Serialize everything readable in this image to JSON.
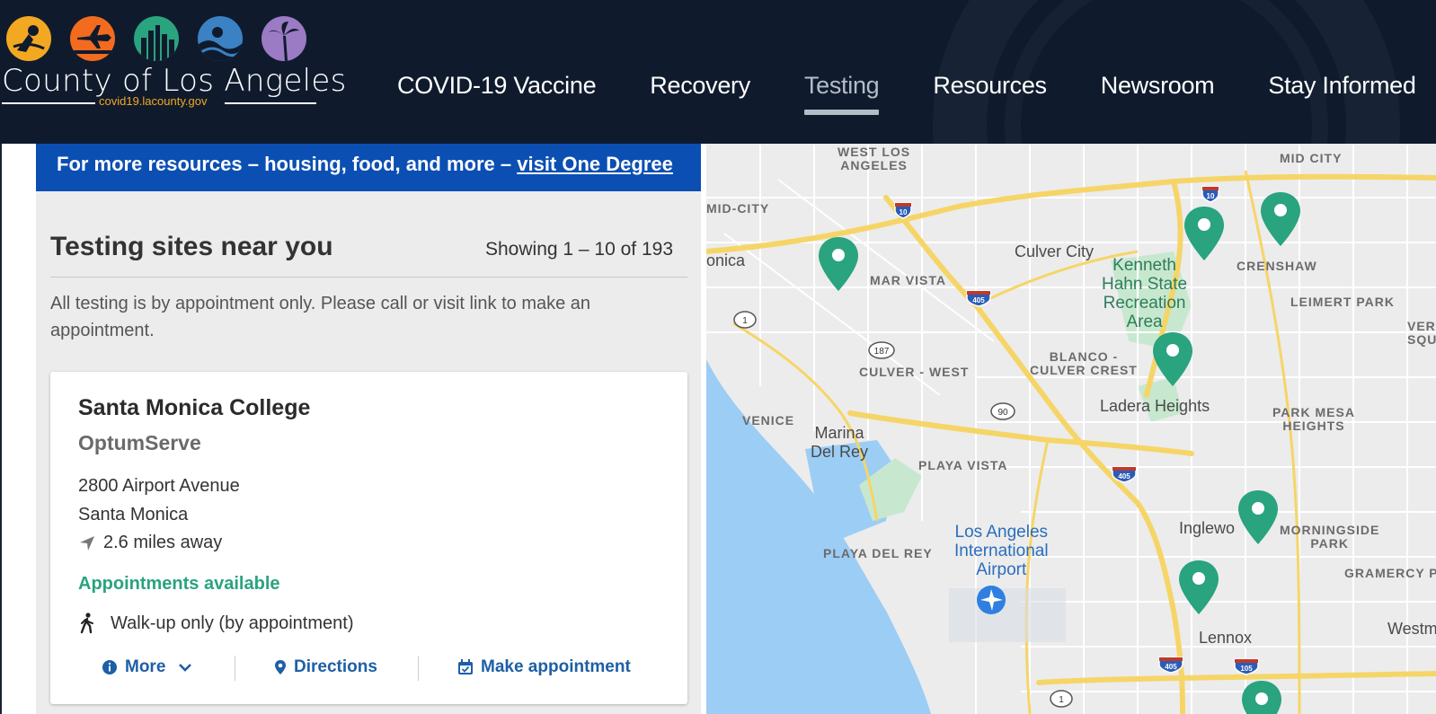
{
  "header": {
    "logo": {
      "title": "County of Los Angeles",
      "url": "covid19.lacounty.gov",
      "icon_colors": [
        "#f3a821",
        "#f26b1f",
        "#2aa37f",
        "#3b82c4",
        "#9b7bc4"
      ]
    },
    "nav": [
      {
        "label": "COVID-19 Vaccine",
        "active": false
      },
      {
        "label": "Recovery",
        "active": false
      },
      {
        "label": "Testing",
        "active": true
      },
      {
        "label": "Resources",
        "active": false
      },
      {
        "label": "Newsroom",
        "active": false
      },
      {
        "label": "Stay Informed",
        "active": false
      }
    ]
  },
  "banner": {
    "text": "For more resources – housing, food, and more –",
    "link": "visit One Degree"
  },
  "results": {
    "title": "Testing sites near you",
    "count": "Showing 1 – 10 of 193",
    "notice": "All testing is by appointment only. Please call or visit link to make an appointment."
  },
  "site": {
    "name": "Santa Monica College",
    "provider": "OptumServe",
    "address_line1": "2800 Airport Avenue",
    "address_line2": "Santa Monica",
    "distance": "2.6 miles away",
    "availability": "Appointments available",
    "walkup": "Walk-up only (by appointment)",
    "actions": {
      "more": "More",
      "directions": "Directions",
      "appointment": "Make appointment"
    }
  },
  "map": {
    "labels": {
      "west_la": "WEST LOS\nANGELES",
      "mid_city_left": "MID-CITY",
      "mid_city_right": "MID CITY",
      "monica": "onica",
      "culver_city": "Culver City",
      "mar_vista": "MAR VISTA",
      "kenneth_hahn": "Kenneth\nHahn State\nRecreation\nArea",
      "crenshaw": "CRENSHAW",
      "leimert": "LEIMERT PARK",
      "verm": "VERM\nSQU",
      "blanco": "BLANCO -\nCULVER CREST",
      "culver_west": "CULVER - WEST",
      "ladera": "Ladera Heights",
      "venice": "VENICE",
      "marina": "Marina\nDel Rey",
      "park_mesa": "PARK MESA\nHEIGHTS",
      "playa_vista": "PLAYA VISTA",
      "lax": "Los Angeles\nInternational\nAirport",
      "inglewood": "Inglewo",
      "morningside": "MORNINGSIDE\nPARK",
      "playa_del_rey": "PLAYA DEL REY",
      "gramercy": "GRAMERCY PI",
      "lennox": "Lennox",
      "westm": "Westmo"
    },
    "shields": [
      "10",
      "10",
      "405",
      "405",
      "405",
      "105",
      "1",
      "187",
      "90",
      "1"
    ],
    "pin_color": "#2aa37f"
  }
}
